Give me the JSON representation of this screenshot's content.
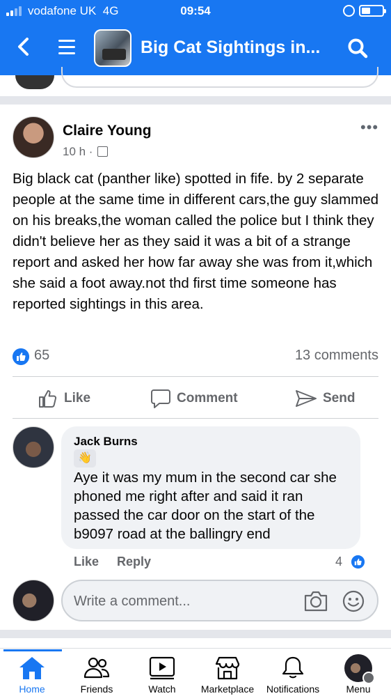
{
  "status_bar": {
    "carrier": "vodafone UK",
    "network": "4G",
    "time": "09:54"
  },
  "header": {
    "title": "Big Cat Sightings in...",
    "back_icon": "chevron-left-icon",
    "menu_icon": "hamburger-icon",
    "search_icon": "search-icon"
  },
  "post": {
    "author": "Claire Young",
    "time": "10 h ·",
    "text": "Big black cat (panther like) spotted in fife. by 2 separate people at the same time in different cars,the guy slammed on his breaks,the woman called the police but I think they didn't believe her as they said it was a bit of a strange report and asked her how far away she was from it,which she said a foot away.not thd first time someone has reported sightings in this area.",
    "likes": "65",
    "comments": "13 comments",
    "actions": {
      "like": "Like",
      "comment": "Comment",
      "send": "Send"
    }
  },
  "comment": {
    "author": "Jack Burns",
    "badge": "👋",
    "text": "Aye it was my mum in the second car she phoned me right after and said it ran passed the car door on the start of the b9097 road at the ballingry end",
    "like_label": "Like",
    "reply_label": "Reply",
    "likes": "4"
  },
  "composer": {
    "placeholder": "Write a comment..."
  },
  "bottom_nav": {
    "items": [
      {
        "label": "Home",
        "active": true
      },
      {
        "label": "Friends"
      },
      {
        "label": "Watch"
      },
      {
        "label": "Marketplace"
      },
      {
        "label": "Notifications"
      },
      {
        "label": "Menu"
      }
    ]
  },
  "colors": {
    "brand": "#1877f2",
    "text_secondary": "#65676b",
    "separator": "#e4e6eb"
  }
}
